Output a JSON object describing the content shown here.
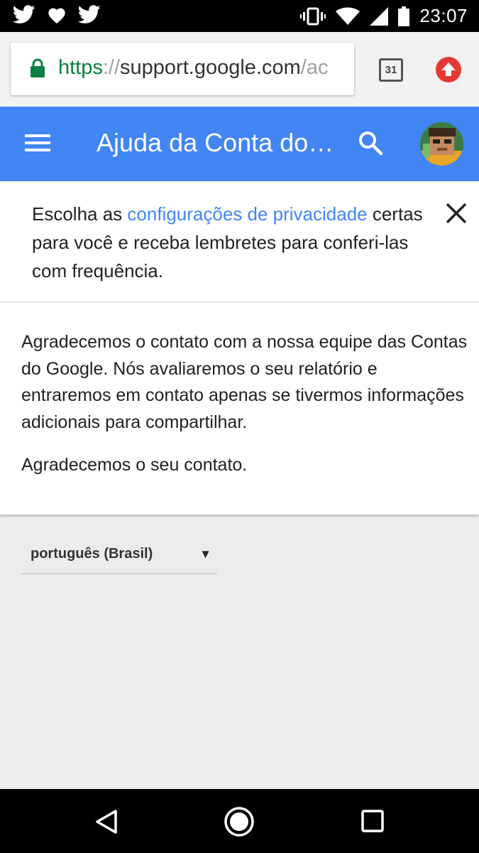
{
  "status_bar": {
    "time": "23:07",
    "left_icons": [
      "twitter-icon",
      "heart-icon",
      "twitter-icon"
    ],
    "right_icons": [
      "vibrate-icon",
      "wifi-icon",
      "signal-icon",
      "battery-icon"
    ]
  },
  "browser": {
    "url_scheme": "https",
    "url_sep": "://",
    "url_host": "support.google.com",
    "url_tail": "/ac",
    "tab_count": "31"
  },
  "appbar": {
    "title": "Ajuda da Conta do…",
    "color": "#4285f4"
  },
  "banner": {
    "text_before": "Escolha as ",
    "link_text": "configurações de privacidade",
    "text_after": " certas para você e receba lembretes para conferi-las com frequência.",
    "link_color": "#4285f4"
  },
  "card": {
    "paragraph1": "Agradecemos o contato com a nossa equipe das Contas do Google. Nós avaliaremos o seu relatório e entraremos em contato apenas se tivermos informações adicionais para compartilhar.",
    "paragraph2": "Agradecemos o seu contato."
  },
  "language_selector": {
    "selected": "português (Brasil)",
    "arrow": "▼"
  }
}
